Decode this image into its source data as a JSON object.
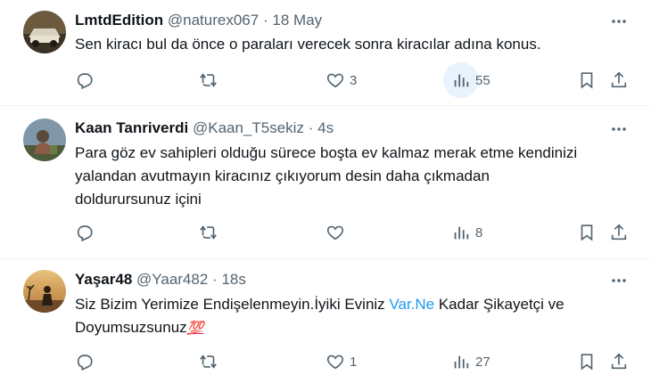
{
  "colors": {
    "text": "#0f1419",
    "muted": "#536471",
    "link": "#1d9bf0",
    "divider": "#eff3f4"
  },
  "tweets": [
    {
      "name": "LmtdEdition",
      "handle": "@naturex067",
      "sep": "·",
      "time": "18 May",
      "text": "Sen kiracı bul da önce o paraları verecek sonra kiracılar adına konus.",
      "replies": "",
      "retweets": "",
      "likes": "3",
      "views": "55"
    },
    {
      "name": "Kaan Tanriverdi",
      "handle": "@Kaan_T5sekiz",
      "sep": "·",
      "time": "4s",
      "text_lines": [
        "Para göz ev sahipleri olduğu sürece boşta ev kalmaz merak etme kendinizi",
        "yalandan avutmayın kiracınız çıkıyorum desin daha çıkmadan",
        "doldurursunuz içini"
      ],
      "replies": "",
      "retweets": "",
      "likes": "",
      "views": "8"
    },
    {
      "name": "Yaşar48",
      "handle": "@Yaar482",
      "sep": "·",
      "time": "18s",
      "text_before_link": "Siz Bizim Yerimize Endişelenmeyin.İyiki Eviniz ",
      "link": "Var.Ne",
      "text_after_link": " Kadar Şikayetçi ve",
      "text_line2": "Doyumsuzsunuz",
      "emoji": "💯",
      "replies": "",
      "retweets": "",
      "likes": "1",
      "views": "27"
    }
  ],
  "icons": [
    "reply-icon",
    "retweet-icon",
    "like-icon",
    "views-icon",
    "bookmark-icon",
    "share-icon",
    "more-icon"
  ]
}
